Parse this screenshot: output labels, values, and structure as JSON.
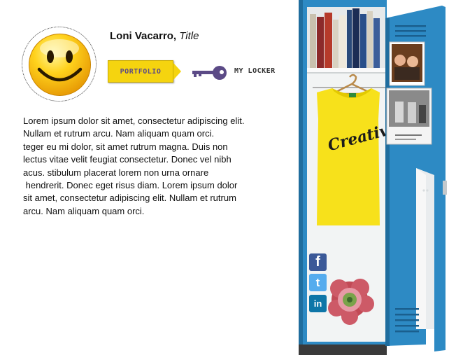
{
  "profile": {
    "name": "Loni Vacarro,",
    "title": "Title",
    "avatar_icon": "smiley-face-icon"
  },
  "nav": {
    "portfolio_label": "PORTFOLIO",
    "locker_label": "MY LOCKER",
    "locker_icon": "key-icon"
  },
  "bio": {
    "lines": [
      "Lorem ipsum dolor sit amet, consectetur adipiscing elit.",
      "Nullam et rutrum arcu. Nam aliquam quam orci.",
      "teger eu mi dolor, sit amet rutrum magna. Duis non",
      "lectus vitae velit feugiat consectetur. Donec vel nibh",
      "acus. stibulum placerat lorem non urna ornare",
      " hendrerit. Donec eget risus diam. Lorem ipsum dolor",
      "sit amet, consectetur adipiscing elit. Nullam et rutrum",
      "arcu. Nam aliquam quam orci."
    ]
  },
  "locker": {
    "shirt_text": "Creative",
    "colors": {
      "locker_blue": "#2d8ac4",
      "shirt_yellow": "#f7e11b"
    }
  },
  "social": {
    "facebook": "f",
    "twitter": "t",
    "linkedin": "in"
  }
}
